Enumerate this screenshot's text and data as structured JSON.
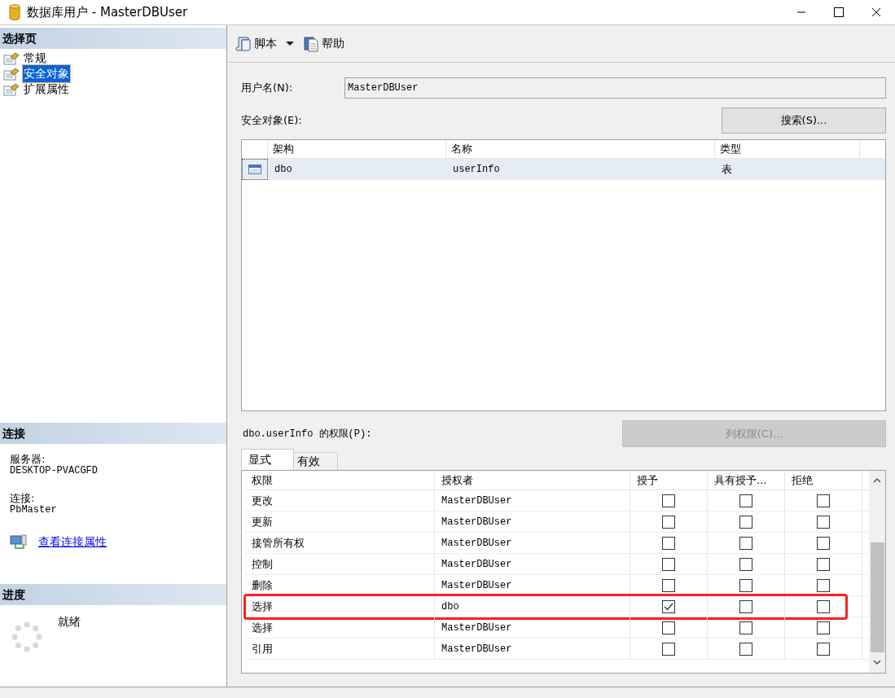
{
  "window": {
    "title": "数据库用户 - MasterDBUser"
  },
  "sidebar": {
    "header": "选择页",
    "pages": [
      {
        "label": "常规",
        "selected": false
      },
      {
        "label": "安全对象",
        "selected": true
      },
      {
        "label": "扩展属性",
        "selected": false
      }
    ]
  },
  "connection": {
    "header": "连接",
    "server_label": "服务器:",
    "server": "DESKTOP-PVACGFD",
    "connection_label": "连接:",
    "connection": "PbMaster",
    "link": "查看连接属性"
  },
  "progress": {
    "header": "进度",
    "status": "就绪"
  },
  "toolbar": [
    {
      "label": "脚本",
      "kind": "script",
      "dropdown": true
    },
    {
      "label": "帮助",
      "kind": "help",
      "dropdown": false
    }
  ],
  "user_name": {
    "label": "用户名(N):",
    "value": "MasterDBUser"
  },
  "securables": {
    "label": "安全对象(E):",
    "search_button": "搜索(S)...",
    "columns": [
      "架构",
      "名称",
      "类型"
    ],
    "rows": [
      {
        "cells": [
          "dbo",
          "userInfo",
          "表"
        ],
        "selected": true
      }
    ]
  },
  "permissions": {
    "label": "dbo.userInfo 的权限(P):",
    "column_button": {
      "label": "列权限(C)...",
      "disabled": true
    },
    "tabs": [
      {
        "label": "显式",
        "selected": true
      },
      {
        "label": "有效",
        "selected": false
      }
    ],
    "columns": [
      "权限",
      "授权者",
      "授予",
      "具有授予...",
      "拒绝"
    ],
    "rows": [
      {
        "permission": "更改",
        "grantor": "MasterDBUser",
        "grant": false,
        "with_grant": false,
        "deny": false,
        "highlighted": false
      },
      {
        "permission": "更新",
        "grantor": "MasterDBUser",
        "grant": false,
        "with_grant": false,
        "deny": false,
        "highlighted": false
      },
      {
        "permission": "接管所有权",
        "grantor": "MasterDBUser",
        "grant": false,
        "with_grant": false,
        "deny": false,
        "highlighted": false
      },
      {
        "permission": "控制",
        "grantor": "MasterDBUser",
        "grant": false,
        "with_grant": false,
        "deny": false,
        "highlighted": false
      },
      {
        "permission": "删除",
        "grantor": "MasterDBUser",
        "grant": false,
        "with_grant": false,
        "deny": false,
        "highlighted": false
      },
      {
        "permission": "选择",
        "grantor": "dbo",
        "grant": true,
        "with_grant": false,
        "deny": false,
        "highlighted": true
      },
      {
        "permission": "选择",
        "grantor": "MasterDBUser",
        "grant": false,
        "with_grant": false,
        "deny": false,
        "highlighted": false
      },
      {
        "permission": "引用",
        "grantor": "MasterDBUser",
        "grant": false,
        "with_grant": false,
        "deny": false,
        "highlighted": false
      }
    ]
  }
}
